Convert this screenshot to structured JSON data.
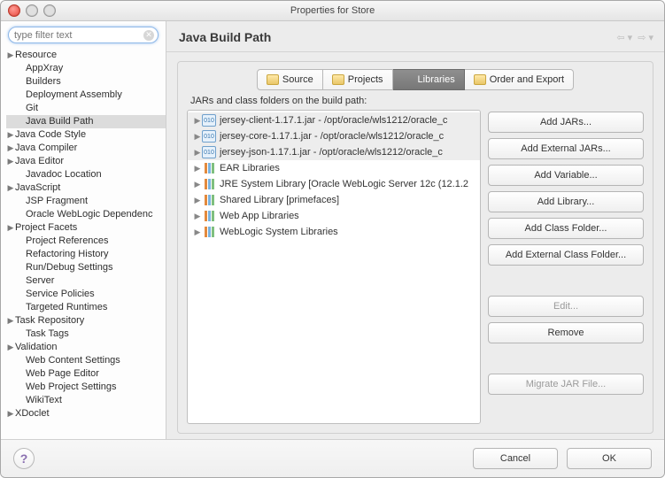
{
  "window": {
    "title": "Properties for Store"
  },
  "filter": {
    "placeholder": "type filter text"
  },
  "sidebar": {
    "items": [
      {
        "label": "Resource",
        "expandable": true,
        "depth": 0
      },
      {
        "label": "AppXray",
        "expandable": false,
        "depth": 1
      },
      {
        "label": "Builders",
        "expandable": false,
        "depth": 1
      },
      {
        "label": "Deployment Assembly",
        "expandable": false,
        "depth": 1
      },
      {
        "label": "Git",
        "expandable": false,
        "depth": 1
      },
      {
        "label": "Java Build Path",
        "expandable": false,
        "depth": 1,
        "selected": true
      },
      {
        "label": "Java Code Style",
        "expandable": true,
        "depth": 0
      },
      {
        "label": "Java Compiler",
        "expandable": true,
        "depth": 0
      },
      {
        "label": "Java Editor",
        "expandable": true,
        "depth": 0
      },
      {
        "label": "Javadoc Location",
        "expandable": false,
        "depth": 1
      },
      {
        "label": "JavaScript",
        "expandable": true,
        "depth": 0
      },
      {
        "label": "JSP Fragment",
        "expandable": false,
        "depth": 1
      },
      {
        "label": "Oracle WebLogic Dependenc",
        "expandable": false,
        "depth": 1
      },
      {
        "label": "Project Facets",
        "expandable": true,
        "depth": 0
      },
      {
        "label": "Project References",
        "expandable": false,
        "depth": 1
      },
      {
        "label": "Refactoring History",
        "expandable": false,
        "depth": 1
      },
      {
        "label": "Run/Debug Settings",
        "expandable": false,
        "depth": 1
      },
      {
        "label": "Server",
        "expandable": false,
        "depth": 1
      },
      {
        "label": "Service Policies",
        "expandable": false,
        "depth": 1
      },
      {
        "label": "Targeted Runtimes",
        "expandable": false,
        "depth": 1
      },
      {
        "label": "Task Repository",
        "expandable": true,
        "depth": 0
      },
      {
        "label": "Task Tags",
        "expandable": false,
        "depth": 1
      },
      {
        "label": "Validation",
        "expandable": true,
        "depth": 0
      },
      {
        "label": "Web Content Settings",
        "expandable": false,
        "depth": 1
      },
      {
        "label": "Web Page Editor",
        "expandable": false,
        "depth": 1
      },
      {
        "label": "Web Project Settings",
        "expandable": false,
        "depth": 1
      },
      {
        "label": "WikiText",
        "expandable": false,
        "depth": 1
      },
      {
        "label": "XDoclet",
        "expandable": true,
        "depth": 0
      }
    ]
  },
  "main": {
    "heading": "Java Build Path",
    "tabs": [
      {
        "label": "Source",
        "icon": "folder"
      },
      {
        "label": "Projects",
        "icon": "folder"
      },
      {
        "label": "Libraries",
        "icon": "books",
        "active": true
      },
      {
        "label": "Order and Export",
        "icon": "folder"
      }
    ],
    "list_heading": "JARs and class folders on the build path:",
    "entries": [
      {
        "label": "jersey-client-1.17.1.jar - /opt/oracle/wls1212/oracle_c",
        "kind": "jar",
        "shaded": true
      },
      {
        "label": "jersey-core-1.17.1.jar - /opt/oracle/wls1212/oracle_c",
        "kind": "jar",
        "shaded": true
      },
      {
        "label": "jersey-json-1.17.1.jar - /opt/oracle/wls1212/oracle_c",
        "kind": "jar",
        "shaded": true
      },
      {
        "label": "EAR Libraries",
        "kind": "lib"
      },
      {
        "label": "JRE System Library [Oracle WebLogic Server 12c (12.1.2",
        "kind": "lib"
      },
      {
        "label": "Shared Library [primefaces]",
        "kind": "lib"
      },
      {
        "label": "Web App Libraries",
        "kind": "lib"
      },
      {
        "label": "WebLogic System Libraries",
        "kind": "lib"
      }
    ],
    "buttons": [
      {
        "id": "add-jars",
        "label": "Add JARs...",
        "disabled": false
      },
      {
        "id": "add-external-jars",
        "label": "Add External JARs...",
        "disabled": false
      },
      {
        "id": "add-variable",
        "label": "Add Variable...",
        "disabled": false
      },
      {
        "id": "add-library",
        "label": "Add Library...",
        "disabled": false
      },
      {
        "id": "add-class-folder",
        "label": "Add Class Folder...",
        "disabled": false
      },
      {
        "id": "add-external-class-folder",
        "label": "Add External Class Folder...",
        "disabled": false
      }
    ],
    "edit_button": {
      "label": "Edit...",
      "disabled": true
    },
    "remove_button": {
      "label": "Remove",
      "disabled": false
    },
    "migrate_button": {
      "label": "Migrate JAR File...",
      "disabled": true
    }
  },
  "footer": {
    "cancel": "Cancel",
    "ok": "OK"
  }
}
